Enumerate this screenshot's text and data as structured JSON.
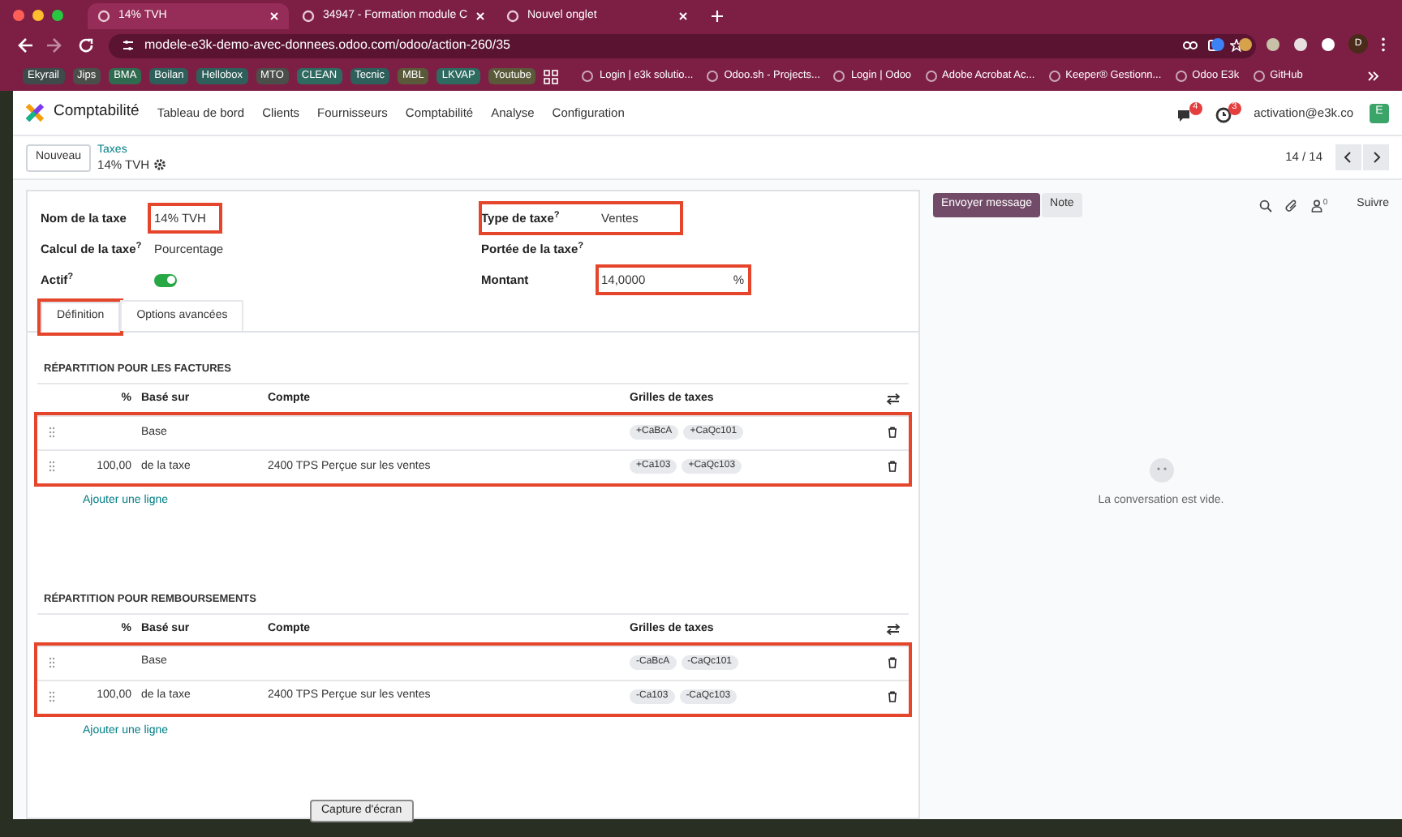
{
  "browser": {
    "tabs": [
      {
        "title": "14% TVH",
        "selected": true
      },
      {
        "title": "34947 - Formation module C",
        "selected": false
      },
      {
        "title": "Nouvel onglet",
        "selected": false
      }
    ],
    "url": "modele-e3k-demo-avec-donnees.odoo.com/odoo/action-260/35",
    "profile": "D",
    "bookmarks": [
      {
        "label": "Ekyrail",
        "kind": "chip",
        "color": "#3f4a4a"
      },
      {
        "label": "Jips",
        "kind": "chip",
        "color": "#4a4f4a"
      },
      {
        "label": "BMA",
        "kind": "chip",
        "color": "#2f6b4f"
      },
      {
        "label": "Boilan",
        "kind": "chip",
        "color": "#2e5f5a"
      },
      {
        "label": "Hellobox",
        "kind": "chip",
        "color": "#2e5f5a"
      },
      {
        "label": "MTO",
        "kind": "chip",
        "color": "#4a4f4a"
      },
      {
        "label": "CLEAN",
        "kind": "chip",
        "color": "#2e6a60"
      },
      {
        "label": "Tecnic",
        "kind": "chip",
        "color": "#2e5f5a"
      },
      {
        "label": "MBL",
        "kind": "chip",
        "color": "#5a5a3a"
      },
      {
        "label": "LKVAP",
        "kind": "chip",
        "color": "#2e6a60"
      },
      {
        "label": "Youtube",
        "kind": "chip",
        "color": "#5a5a3a"
      },
      {
        "label": "Login | e3k solutio...",
        "kind": "link"
      },
      {
        "label": "Odoo.sh - Projects...",
        "kind": "link"
      },
      {
        "label": "Login | Odoo",
        "kind": "link"
      },
      {
        "label": "Adobe Acrobat Ac...",
        "kind": "link"
      },
      {
        "label": "Keeper® Gestionn...",
        "kind": "link"
      },
      {
        "label": "Odoo E3k",
        "kind": "link"
      },
      {
        "label": "GitHub",
        "kind": "link"
      }
    ]
  },
  "navbar": {
    "app": "Comptabilité",
    "menus": [
      "Tableau de bord",
      "Clients",
      "Fournisseurs",
      "Comptabilité",
      "Analyse",
      "Configuration"
    ],
    "messages_badge": "4",
    "activities_badge": "3",
    "user": "activation@e3k.co",
    "avatar": "E"
  },
  "control_panel": {
    "new_button": "Nouveau",
    "breadcrumb": "Taxes",
    "record": "14% TVH",
    "pager": "14 / 14"
  },
  "form": {
    "left_fields": [
      {
        "label": "Nom de la taxe",
        "kind": "text",
        "value": "14% TVH",
        "highlighted": true
      },
      {
        "label": "Calcul de la taxe$^{?}$",
        "kind": "text",
        "value": "Pourcentage",
        "highlighted": false
      },
      {
        "label": "Actif$^{?}$",
        "kind": "toggle",
        "on": true,
        "highlighted": false
      }
    ],
    "right_fields": [
      {
        "label": "Type de taxe$^{?}$",
        "kind": "text",
        "value": "Ventes",
        "highlighted": true,
        "label_highlighted": true
      },
      {
        "label": "Portée de la taxe$^{?}$",
        "kind": "text",
        "highlighted": false
      },
      {
        "label": "Montant",
        "kind": "amount",
        "value": "14,0000",
        "unit": "%",
        "highlighted": true
      }
    ],
    "tabs": [
      {
        "label": "Définition",
        "selected": true,
        "highlighted": true
      },
      {
        "label": "Options avancées",
        "selected": false,
        "highlighted": false
      }
    ],
    "sections": [
      {
        "title": "RÉPARTITION POUR LES FACTURES",
        "columns": [
          "%",
          "Basé sur",
          "Compte",
          "Grilles de taxes"
        ],
        "highlighted": true,
        "rows": [
          {
            "percent": "",
            "based_on": "Base",
            "account": "",
            "tags": [
              "+CaBcA",
              "+CaQc101"
            ]
          },
          {
            "percent": "100,00",
            "based_on": "de la taxe",
            "account": "2400 TPS Perçue sur les ventes",
            "tags": [
              "+Ca103",
              "+CaQc103"
            ]
          }
        ],
        "add_line": "Ajouter une ligne"
      },
      {
        "title": "RÉPARTITION POUR REMBOURSEMENTS",
        "columns": [
          "%",
          "Basé sur",
          "Compte",
          "Grilles de taxes"
        ],
        "highlighted": true,
        "rows": [
          {
            "percent": "",
            "based_on": "Base",
            "account": "",
            "tags": [
              "-CaBcA",
              "-CaQc101"
            ]
          },
          {
            "percent": "100,00",
            "based_on": "de la taxe",
            "account": "2400 TPS Perçue sur les ventes",
            "tags": [
              "-Ca103",
              "-CaQc103"
            ]
          }
        ],
        "add_line": "Ajouter une ligne"
      }
    ]
  },
  "chatter": {
    "send_button": "Envoyer message",
    "note_button": "Note",
    "followers": "0",
    "follow": "Suivre",
    "empty": "La conversation est vide."
  },
  "tooltip": "Capture d'écran"
}
